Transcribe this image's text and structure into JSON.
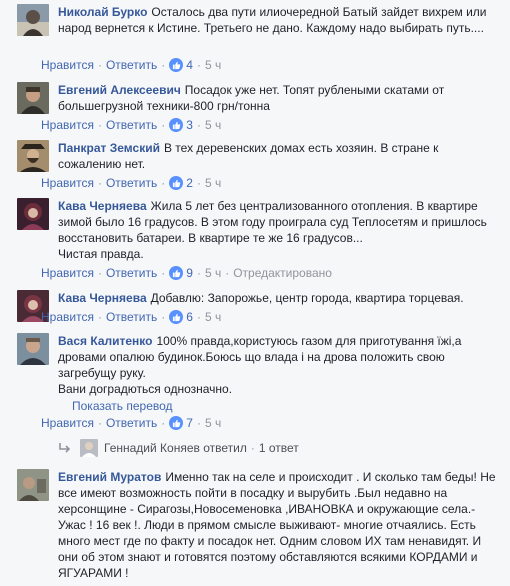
{
  "comments": [
    {
      "author": "Николай Бурко",
      "text": "Осталось два пути илиочередной Батый зайдет вихрем или народ вернется к Истине. Третьего не дано. Каждому надо выбирать путь....",
      "like": "Нравится",
      "reply": "Ответить",
      "likes": "4",
      "time": "5 ч"
    },
    {
      "author": "Евгений Алексеевич",
      "text": "Посадок уже нет. Топят рублеными скатами от большегрузной техники-800 грн/тонна",
      "like": "Нравится",
      "reply": "Ответить",
      "likes": "3",
      "time": "5 ч"
    },
    {
      "author": "Панкрат Земский",
      "text": "В тех деревенских домах есть хозяин. В стране к сожалению нет.",
      "like": "Нравится",
      "reply": "Ответить",
      "likes": "2",
      "time": "5 ч"
    },
    {
      "author": "Кава Черняева",
      "text": "Жила 5 лет без централизованного отопления. В квартире зимой было 16 градусов. В этом году проиграла суд Теплосетям и пришлось восстановить батареи. В квартире те же 16 градусов...",
      "text2": "Чистая правда.",
      "like": "Нравится",
      "reply": "Ответить",
      "likes": "9",
      "time": "5 ч",
      "edited": "Отредактировано"
    },
    {
      "author": "Кава Черняева",
      "text": "Добавлю: Запорожье, центр города, квартира торцевая.",
      "like": "Нравится",
      "reply": "Ответить",
      "likes": "6",
      "time": "5 ч"
    },
    {
      "author": "Вася Калитенко",
      "text": "100% правда,користуюсь газом для приготування їжі,а дровами опалюю будинок.Боюсь що влада і на дрова положить свою загребущу руку.",
      "text2": "Вани доградються однозначно.",
      "translate": "Показать перевод",
      "like": "Нравится",
      "reply": "Ответить",
      "likes": "7",
      "time": "5 ч"
    },
    {
      "author": "Евгений Муратов",
      "text": "Именно так на селе и происходит . И сколько там беды! Не все имеют возможность пойти в посадку и вырубить .Был недавно на херсонщине - Сирагозы,Новосеменовка ,ИВАНОВКА и окружающие села.- Ужас ! 16 век !. Люди в прямом смысле выживают- многие отчаялись. Есть много мест где по факту и посадок нет. Одним словом ИХ там ненавидят. И они об этом знают и готовятся поэтому обставляются всякими КОРДАМИ и ЯГУАРАМИ !"
    }
  ],
  "replies": {
    "author": "Геннадий Коняев",
    "verb": "ответил",
    "count": "1 ответ"
  },
  "colors": {
    "link": "#4267b2",
    "author": "#365899",
    "meta": "#90949c",
    "like_badge": "#5890ff",
    "background": "#f6f7f9"
  },
  "icons": {
    "like": "thumbs-up-icon",
    "reply_arrow": "reply-arrow-icon"
  }
}
